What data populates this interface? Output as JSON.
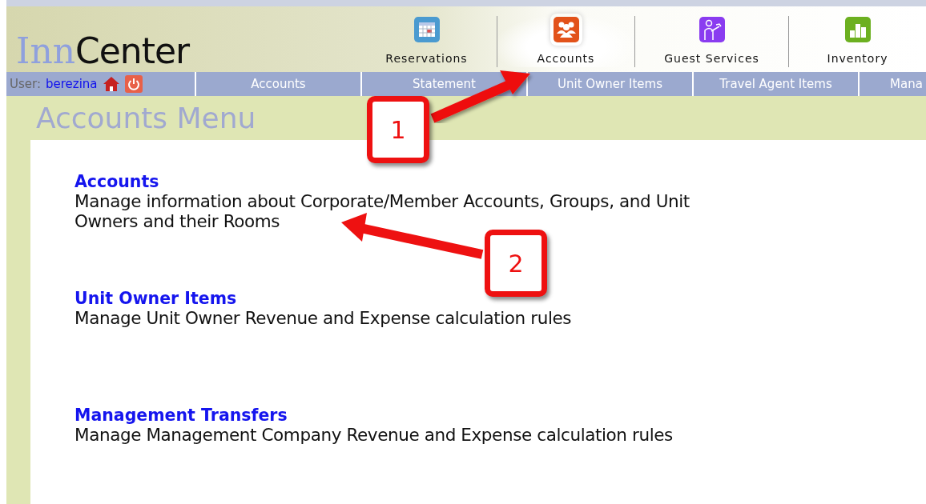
{
  "logo": {
    "light": "Inn",
    "dark": "Center"
  },
  "modules": [
    {
      "label": "Reservations",
      "kind": "calendar",
      "selected": false
    },
    {
      "label": "Accounts",
      "kind": "people",
      "selected": true
    },
    {
      "label": "Guest Services",
      "kind": "waiter",
      "selected": false
    },
    {
      "label": "Inventory",
      "kind": "blocks",
      "selected": false
    }
  ],
  "user": {
    "label": "User:",
    "name": "berezina"
  },
  "nav": [
    "Accounts",
    "Statement",
    "Unit Owner Items",
    "Travel Agent Items",
    "Mana"
  ],
  "page_title": "Accounts Menu",
  "items": [
    {
      "title": "Accounts",
      "description": "Manage information about Corporate/Member Accounts, Groups, and Unit Owners and their Rooms"
    },
    {
      "title": "Unit Owner Items",
      "description": "Manage Unit Owner Revenue and Expense calculation rules"
    },
    {
      "title": "Management Transfers",
      "description": "Manage Management Company Revenue and Expense calculation rules"
    }
  ],
  "callouts": [
    "1",
    "2"
  ]
}
